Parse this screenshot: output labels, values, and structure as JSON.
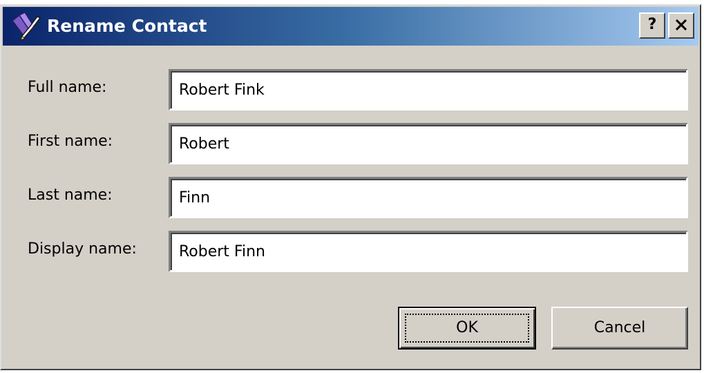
{
  "window": {
    "title": "Rename Contact",
    "icon": "rename-contact-icon",
    "help_label": "?",
    "close_icon": "close-icon"
  },
  "fields": {
    "full_name": {
      "label": "Full name:",
      "value": "Robert Fink"
    },
    "first_name": {
      "label": "First name:",
      "value": "Robert"
    },
    "last_name": {
      "label": "Last name:",
      "value": "Finn"
    },
    "display_name": {
      "label": "Display name:",
      "value": "Robert Finn"
    }
  },
  "buttons": {
    "ok_label": "OK",
    "cancel_label": "Cancel"
  },
  "colors": {
    "titlebar_start": "#0a246a",
    "titlebar_end": "#a6caf0",
    "dialog_face": "#d4d0c8"
  }
}
